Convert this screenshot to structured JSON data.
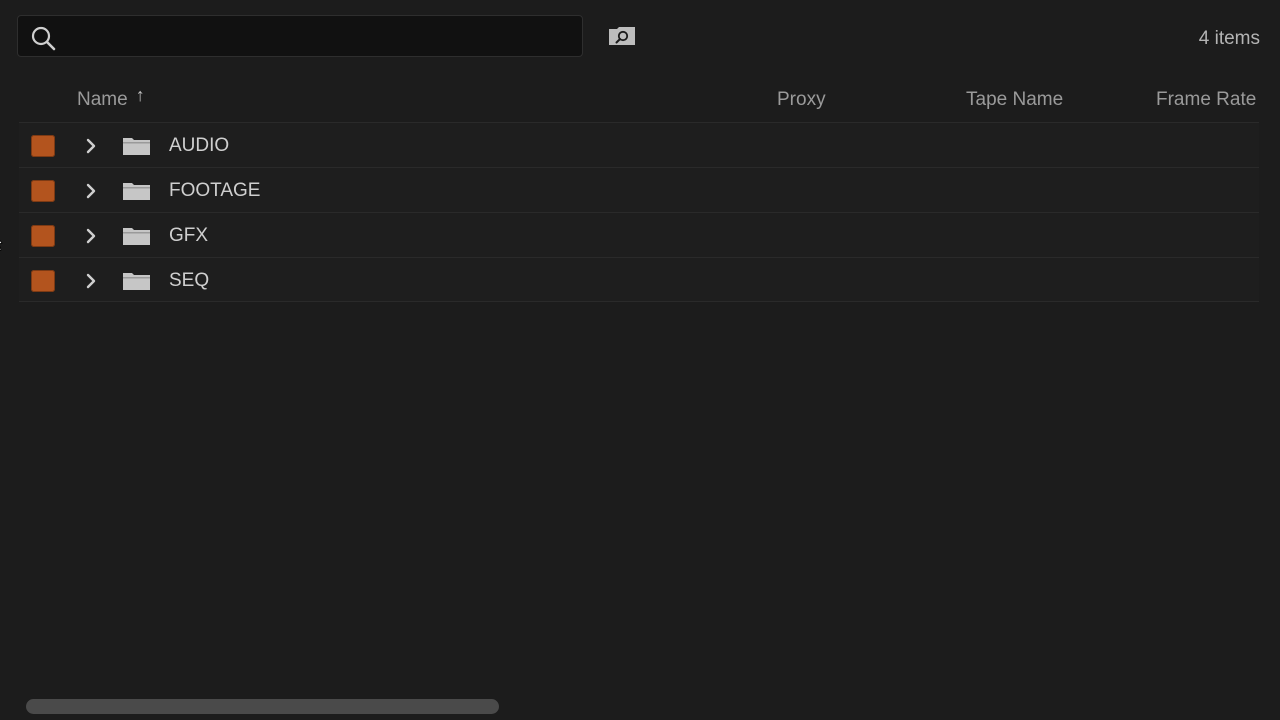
{
  "search": {
    "value": "",
    "placeholder": ""
  },
  "toolbar": {
    "find_icon": "find-folder-icon",
    "item_count": "4 items"
  },
  "columns": {
    "name": "Name",
    "name_sort": "↑",
    "proxy": "Proxy",
    "tape_name": "Tape Name",
    "frame_rate": "Frame Rate"
  },
  "rows": [
    {
      "label_color": "#b3541e",
      "name": "AUDIO"
    },
    {
      "label_color": "#b3541e",
      "name": "FOOTAGE"
    },
    {
      "label_color": "#b3541e",
      "name": "GFX"
    },
    {
      "label_color": "#b3541e",
      "name": "SEQ"
    }
  ],
  "colors": {
    "background": "#1c1c1c",
    "label_orange": "#b3541e",
    "text": "#cfcfcf"
  }
}
